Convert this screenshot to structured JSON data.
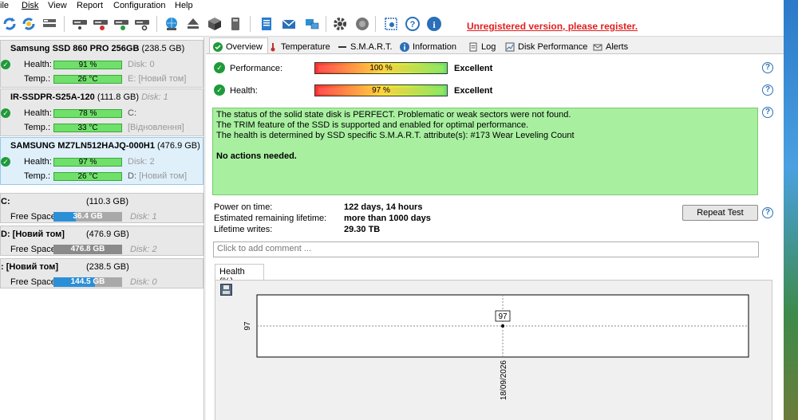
{
  "menu": [
    "ile",
    "Disk",
    "View",
    "Report",
    "Configuration",
    "Help"
  ],
  "toolbar": {
    "unregistered_text": "Unregistered version, please register."
  },
  "disks": [
    {
      "name": "Samsung SSD 860 PRO 256GB",
      "size": "(238.5 GB)",
      "health_label": "Health:",
      "health": "91 %",
      "health_value": 0.91,
      "temp_label": "Temp.:",
      "temp": "26 °C",
      "disk_idx": "Disk: 0",
      "volume": "E: [Новий том]"
    },
    {
      "name": "IR-SSDPR-S25A-120",
      "size": "(111.8 GB)",
      "disk_idx": "Disk: 1",
      "health_label": "Health:",
      "health": "78 %",
      "health_value": 0.78,
      "temp_label": "Temp.:",
      "temp": "33 °C",
      "volume": "C:",
      "volume2": "[Відновлення]"
    },
    {
      "name": "SAMSUNG MZ7LN512HAJQ-000H1",
      "size": "(476.9 GB)",
      "health_label": "Health:",
      "health": "97 %",
      "health_value": 0.97,
      "temp_label": "Temp.:",
      "temp": "26 °C",
      "disk_idx": "Disk: 2",
      "volume": "D:",
      "volume2": "[Новий том]"
    }
  ],
  "volumes": [
    {
      "name": "C:",
      "size": "(110.3 GB)",
      "free_label": "Free Space",
      "free": "36.4 GB",
      "used_fraction": 0.33,
      "disk": "Disk: 1"
    },
    {
      "name": "D: [Новий том]",
      "size": "(476.9 GB)",
      "free_label": "Free Space",
      "free": "476.8 GB",
      "used_fraction": 1.0,
      "disk": "Disk: 2"
    },
    {
      "name": ": [Новий том]",
      "size": "(238.5 GB)",
      "free_label": "Free Space",
      "free": "144.5 GB",
      "used_fraction": 0.6,
      "disk": "Disk: 0"
    }
  ],
  "tabs": [
    "Overview",
    "Temperature",
    "S.M.A.R.T.",
    "Information",
    "Log",
    "Disk Performance",
    "Alerts"
  ],
  "overview": {
    "performance_label": "Performance:",
    "performance_pct": "100 %",
    "performance_value": "Excellent",
    "health_label": "Health:",
    "health_pct": "97 %",
    "health_value": "Excellent",
    "status_lines": [
      "The status of the solid state disk is PERFECT. Problematic or weak sectors were not found.",
      "The TRIM feature of the SSD is supported and enabled for optimal performance.",
      "The health is determined by SSD specific S.M.A.R.T. attribute(s):  #173 Wear Leveling Count"
    ],
    "status_action": "No actions needed.",
    "power_on_label": "Power on time:",
    "power_on_value": "122 days, 14 hours",
    "remaining_label": "Estimated remaining lifetime:",
    "remaining_value": "more than 1000 days",
    "writes_label": "Lifetime writes:",
    "writes_value": "29.30 TB",
    "repeat_button": "Repeat Test",
    "comment_placeholder": "Click to add comment ...",
    "help_glyph": "?"
  },
  "chart_tab": "Health (%)",
  "chart_data": {
    "type": "line",
    "x": [
      "18/09/2026"
    ],
    "values": [
      97
    ],
    "y_tick": "97",
    "point_label": "97"
  }
}
